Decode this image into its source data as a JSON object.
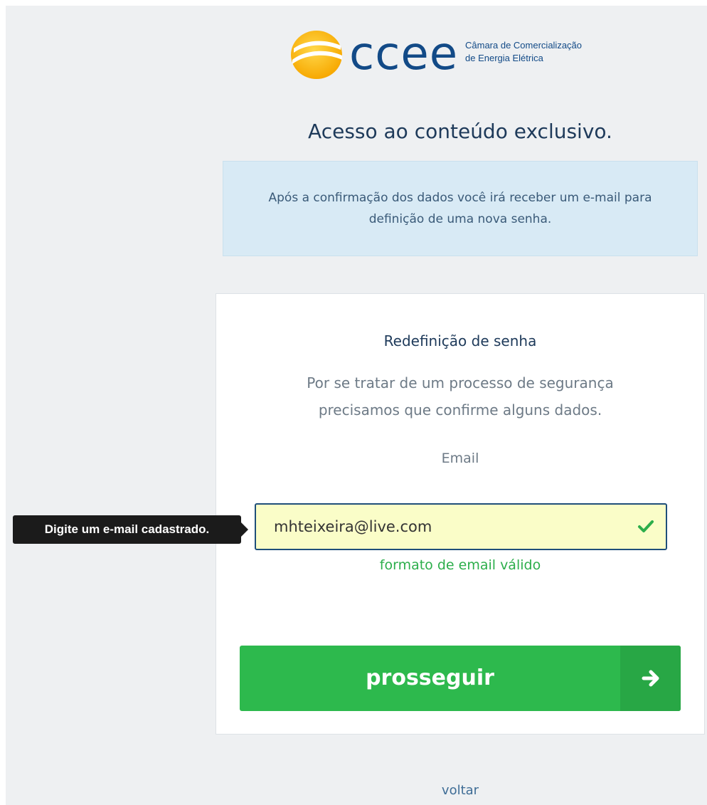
{
  "logo": {
    "icon": "ccee-sun-logo-icon",
    "wordmark": "ccee",
    "tagline_line1": "Câmara de Comercialização",
    "tagline_line2": "de Energia Elétrica"
  },
  "page_heading": "Acesso ao conteúdo exclusivo.",
  "info_box": {
    "text": "Após a confirmação dos dados você irá receber um e-mail para definição de uma nova senha."
  },
  "card": {
    "title": "Redefinição de senha",
    "desc_line1": "Por se tratar de um processo de segurança",
    "desc_line2": "precisamos que confirme alguns dados.",
    "email_label": "Email",
    "email_value": "mhteixeira@live.com",
    "valid_message": "formato de email válido",
    "submit_label": "prosseguir"
  },
  "tooltip": {
    "text": "Digite um e-mail cadastrado."
  },
  "back_link": "voltar",
  "colors": {
    "brand_blue": "#124a87",
    "brand_yellow": "#f7b500",
    "success_green": "#2db94d",
    "input_bg": "#fafdc8",
    "info_bg": "#d8eaf5"
  },
  "icons": {
    "check": "check-icon",
    "arrow": "arrow-right-icon"
  }
}
